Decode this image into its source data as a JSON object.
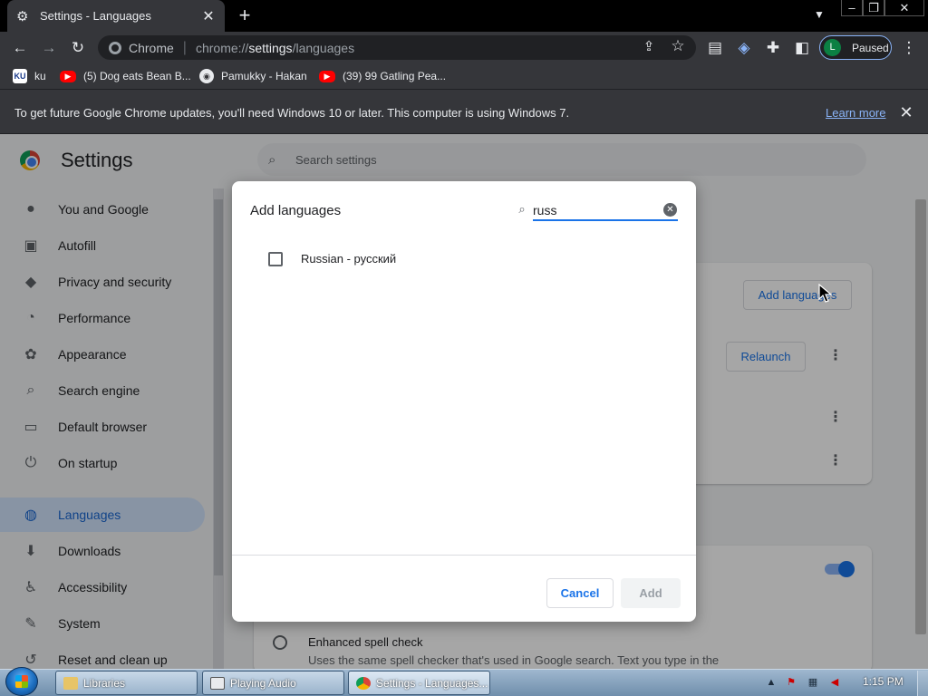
{
  "tab": {
    "title": "Settings - Languages",
    "icon": "gear-icon"
  },
  "toolbar": {
    "omnibox_label": "Chrome",
    "url_prefix": "chrome://",
    "url_host": "settings",
    "url_path": "/languages",
    "profile_initial": "L",
    "profile_status": "Paused"
  },
  "bookmarks": [
    {
      "label": "ku",
      "icon": "ku-favicon"
    },
    {
      "label": "(5) Dog eats Bean B...",
      "icon": "youtube-icon"
    },
    {
      "label": "Pamukky - Hakan",
      "icon": "globe-icon"
    },
    {
      "label": "(39) 99 Gatling Pea...",
      "icon": "youtube-icon"
    }
  ],
  "infobar": {
    "message": "To get future Google Chrome updates, you'll need Windows 10 or later. This computer is using Windows 7.",
    "link": "Learn more"
  },
  "settings": {
    "title": "Settings",
    "search_placeholder": "Search settings",
    "nav": [
      {
        "label": "You and Google",
        "icon": "person-icon"
      },
      {
        "label": "Autofill",
        "icon": "clipboard-icon"
      },
      {
        "label": "Privacy and security",
        "icon": "shield-icon"
      },
      {
        "label": "Performance",
        "icon": "speedometer-icon"
      },
      {
        "label": "Appearance",
        "icon": "palette-icon"
      },
      {
        "label": "Search engine",
        "icon": "search-icon"
      },
      {
        "label": "Default browser",
        "icon": "browser-icon"
      },
      {
        "label": "On startup",
        "icon": "power-icon"
      },
      {
        "label": "Languages",
        "icon": "globe-icon",
        "active": true
      },
      {
        "label": "Downloads",
        "icon": "download-icon"
      },
      {
        "label": "Accessibility",
        "icon": "accessibility-icon"
      },
      {
        "label": "System",
        "icon": "wrench-icon"
      },
      {
        "label": "Reset and clean up",
        "icon": "reset-icon"
      }
    ],
    "add_languages_button": "Add languages",
    "relaunch_button": "Relaunch",
    "enhanced_spell_title": "Enhanced spell check",
    "enhanced_spell_desc": "Uses the same spell checker that's used in Google search. Text you type in the"
  },
  "dialog": {
    "title": "Add languages",
    "search_value": "russ",
    "result_label": "Russian - русский",
    "result_checked": false,
    "cancel": "Cancel",
    "add": "Add"
  },
  "taskbar": {
    "tasks": [
      {
        "label": "Libraries"
      },
      {
        "label": "Playing Audio"
      },
      {
        "label": "Settings - Languages..."
      }
    ],
    "clock": "1:15 PM"
  }
}
